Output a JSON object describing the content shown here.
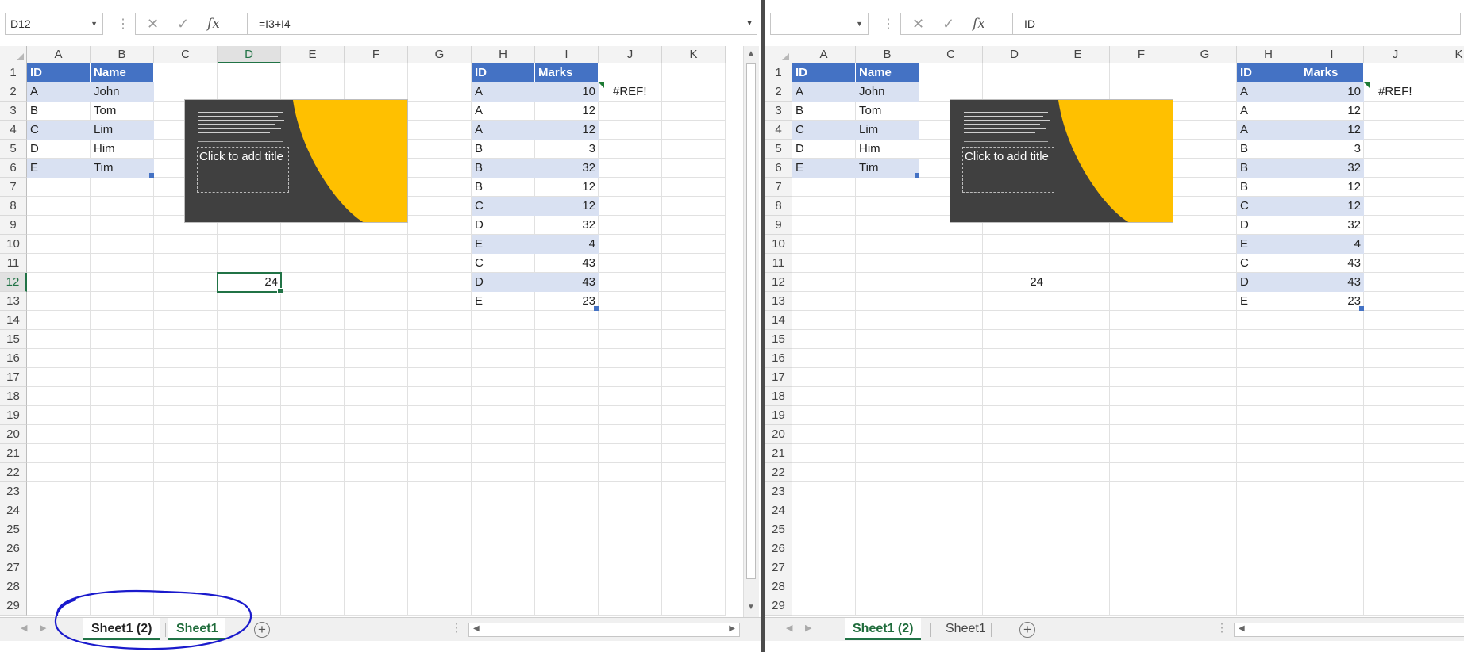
{
  "left_pane": {
    "name_box": "D12",
    "formula": "=I3+I4",
    "tabs": [
      {
        "label": "Sheet1 (2)",
        "active": true
      },
      {
        "label": "Sheet1",
        "active": true
      }
    ]
  },
  "right_pane": {
    "name_box": "",
    "formula": "ID",
    "tabs": [
      {
        "label": "Sheet1 (2)",
        "active": true
      },
      {
        "label": "Sheet1",
        "active": false
      }
    ]
  },
  "columns": [
    "A",
    "B",
    "C",
    "D",
    "E",
    "F",
    "G",
    "H",
    "I",
    "J",
    "K"
  ],
  "rows": [
    "1",
    "2",
    "3",
    "4",
    "5",
    "6",
    "7",
    "8",
    "9",
    "10",
    "11",
    "12",
    "13",
    "14",
    "15",
    "16",
    "17",
    "18",
    "19",
    "20",
    "21",
    "22",
    "23",
    "24",
    "25",
    "26",
    "27",
    "28",
    "29"
  ],
  "table1": {
    "headers": [
      "ID",
      "Name"
    ],
    "rows": [
      [
        "A",
        "John"
      ],
      [
        "B",
        "Tom"
      ],
      [
        "C",
        "Lim"
      ],
      [
        "D",
        "Him"
      ],
      [
        "E",
        "Tim"
      ]
    ]
  },
  "table2": {
    "headers": [
      "ID",
      "Marks"
    ],
    "rows": [
      [
        "A",
        "10"
      ],
      [
        "A",
        "12"
      ],
      [
        "A",
        "12"
      ],
      [
        "B",
        "3"
      ],
      [
        "B",
        "32"
      ],
      [
        "B",
        "12"
      ],
      [
        "C",
        "12"
      ],
      [
        "D",
        "32"
      ],
      [
        "E",
        "4"
      ],
      [
        "C",
        "43"
      ],
      [
        "D",
        "43"
      ],
      [
        "E",
        "23"
      ]
    ]
  },
  "error_cell": "#REF!",
  "d12_value": "24",
  "slide": {
    "placeholder": "Click to add title",
    "colors": {
      "background": "#404040",
      "accent": "#ffc000"
    }
  },
  "formula_bar": {
    "cancel_icon": "✕",
    "enter_icon": "✓",
    "fx_label": "fx"
  },
  "icons": [
    "dropdown-icon",
    "cancel-icon",
    "enter-icon",
    "fx-icon",
    "filter-icon",
    "add-sheet-icon",
    "scroll-arrow-icon"
  ],
  "colors": {
    "table_header": "#4472c4",
    "table_band": "#d9e1f2",
    "excel_green": "#217346",
    "annotation": "#1a1acc"
  }
}
